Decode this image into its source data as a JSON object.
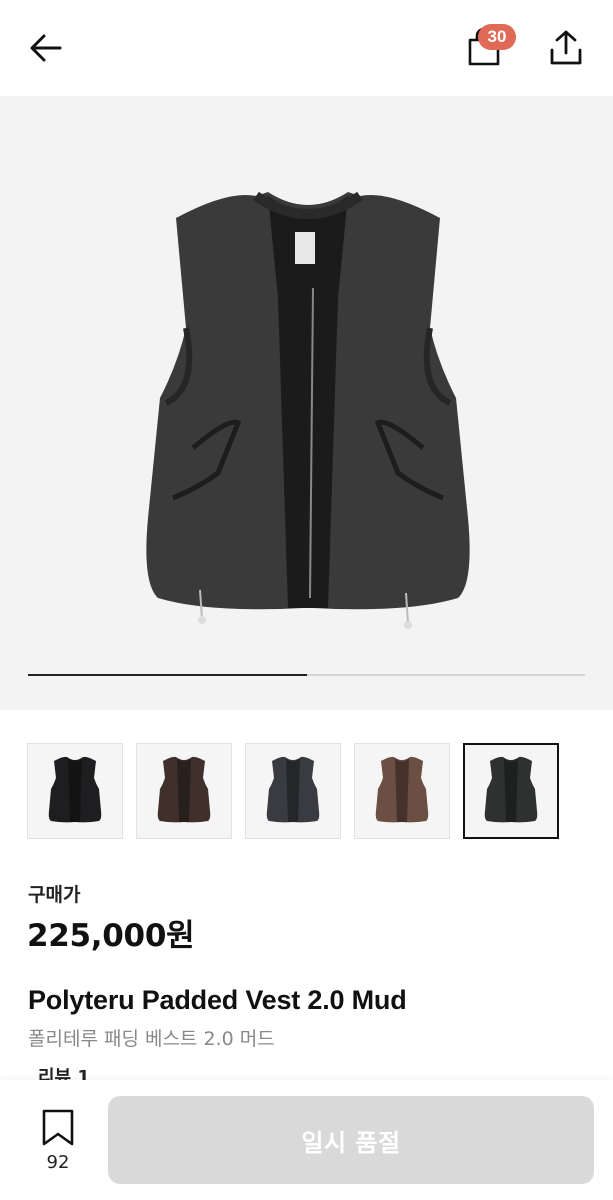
{
  "header": {
    "back_icon": "arrow-left-icon",
    "bag_icon": "shopping-bag-icon",
    "cart_count": "30",
    "share_icon": "share-icon"
  },
  "gallery": {
    "progress": 0.5,
    "thumbnails": [
      {
        "color": "#1e1e20",
        "selected": false
      },
      {
        "color": "#3f302b",
        "selected": false
      },
      {
        "color": "#3a3b40",
        "selected": false
      },
      {
        "color": "#6a4f42",
        "selected": false
      },
      {
        "color": "#2f3131",
        "selected": true
      }
    ]
  },
  "product": {
    "price_label": "구매가",
    "price": "225,000원",
    "title_en": "Polyteru Padded Vest 2.0 Mud",
    "title_ko": "폴리테루 패딩 베스트 2.0 머드",
    "review_label": "리뷰 1"
  },
  "bottom": {
    "bookmark_icon": "bookmark-icon",
    "bookmark_count": "92",
    "cta_label": "일시 품절"
  },
  "colors": {
    "badge": "#e06a57",
    "cta_disabled": "#d9d9d9",
    "hero_bg": "#f3f3f3"
  }
}
